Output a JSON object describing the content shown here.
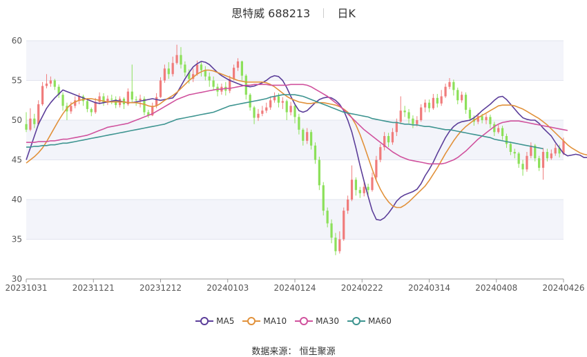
{
  "header": {
    "title": "思特威 688213",
    "period": "日K"
  },
  "source": {
    "label": "数据来源：",
    "name": "恒生聚源"
  },
  "chart_data": {
    "type": "candlestick",
    "ylim": [
      30,
      60
    ],
    "yticks": [
      30,
      35,
      40,
      45,
      50,
      55,
      60
    ],
    "xticks": [
      "20231031",
      "20231121",
      "20231212",
      "20240103",
      "20240124",
      "20240222",
      "20240314",
      "20240408",
      "20240426"
    ],
    "grid": true,
    "legend_position": "bottom",
    "up_color": "#f07c7c",
    "down_color": "#8ce05a",
    "candles": [
      [
        49.5,
        48.8,
        51.0,
        48.5
      ],
      [
        48.8,
        50.2,
        51.5,
        48.6
      ],
      [
        50.2,
        49.5,
        50.8,
        49.0
      ],
      [
        49.5,
        52.0,
        52.5,
        49.3
      ],
      [
        52.0,
        54.3,
        54.8,
        51.8
      ],
      [
        54.3,
        54.6,
        55.8,
        54.0
      ],
      [
        54.6,
        55.0,
        55.5,
        54.2
      ],
      [
        55.0,
        54.2,
        55.2,
        53.8
      ],
      [
        54.2,
        53.2,
        54.5,
        52.8
      ],
      [
        53.2,
        51.8,
        53.5,
        51.2
      ],
      [
        51.8,
        51.1,
        52.2,
        50.0
      ],
      [
        51.1,
        51.8,
        52.3,
        50.8
      ],
      [
        51.8,
        52.5,
        53.0,
        51.5
      ],
      [
        52.5,
        53.0,
        53.4,
        52.0
      ],
      [
        53.0,
        52.4,
        53.2,
        51.8
      ],
      [
        52.4,
        51.4,
        52.6,
        51.0
      ],
      [
        51.4,
        51.0,
        51.6,
        50.5
      ],
      [
        51.0,
        52.3,
        52.8,
        50.8
      ],
      [
        52.3,
        53.0,
        53.5,
        52.0
      ],
      [
        53.0,
        52.2,
        53.4,
        51.8
      ],
      [
        52.2,
        52.7,
        53.1,
        51.9
      ],
      [
        52.7,
        52.6,
        53.2,
        52.0
      ],
      [
        52.6,
        51.9,
        53.0,
        51.5
      ],
      [
        51.9,
        52.7,
        53.0,
        51.6
      ],
      [
        52.7,
        52.0,
        52.9,
        51.4
      ],
      [
        52.0,
        53.6,
        54.0,
        51.8
      ],
      [
        53.6,
        52.6,
        57.0,
        52.2
      ],
      [
        52.6,
        52.5,
        53.0,
        51.8
      ],
      [
        52.5,
        52.7,
        53.2,
        51.6
      ],
      [
        52.7,
        51.0,
        53.0,
        50.6
      ],
      [
        51.0,
        50.6,
        51.3,
        50.3
      ],
      [
        50.6,
        51.8,
        52.2,
        50.5
      ],
      [
        51.8,
        52.9,
        53.4,
        51.5
      ],
      [
        52.9,
        55.0,
        55.4,
        52.8
      ],
      [
        55.0,
        56.5,
        57.0,
        54.7
      ],
      [
        56.5,
        55.8,
        57.3,
        55.2
      ],
      [
        55.8,
        57.2,
        58.0,
        55.5
      ],
      [
        57.2,
        58.2,
        59.5,
        57.0
      ],
      [
        58.2,
        57.0,
        59.2,
        56.5
      ],
      [
        57.0,
        56.0,
        57.4,
        55.5
      ],
      [
        56.0,
        55.2,
        56.4,
        54.6
      ],
      [
        55.2,
        55.8,
        56.5,
        54.8
      ],
      [
        55.8,
        57.0,
        57.5,
        55.6
      ],
      [
        57.0,
        56.3,
        57.3,
        55.5
      ],
      [
        56.3,
        55.5,
        56.8,
        55.0
      ],
      [
        55.5,
        55.0,
        56.0,
        54.2
      ],
      [
        55.0,
        54.2,
        55.5,
        53.8
      ],
      [
        54.2,
        53.6,
        54.6,
        53.0
      ],
      [
        53.6,
        54.2,
        54.6,
        53.2
      ],
      [
        54.2,
        53.7,
        54.8,
        53.1
      ],
      [
        53.7,
        55.2,
        55.6,
        53.4
      ],
      [
        55.2,
        56.6,
        57.0,
        55.0
      ],
      [
        56.6,
        57.4,
        57.8,
        56.2
      ],
      [
        57.4,
        55.6,
        57.5,
        55.0
      ],
      [
        55.6,
        53.2,
        55.8,
        52.6
      ],
      [
        53.2,
        51.6,
        53.4,
        51.2
      ],
      [
        51.6,
        50.3,
        51.8,
        49.5
      ],
      [
        50.3,
        50.8,
        51.4,
        49.9
      ],
      [
        50.8,
        51.2,
        51.8,
        50.5
      ],
      [
        51.2,
        51.6,
        52.2,
        50.9
      ],
      [
        51.6,
        52.5,
        53.0,
        51.3
      ],
      [
        52.5,
        53.0,
        53.5,
        52.2
      ],
      [
        53.0,
        52.2,
        53.4,
        51.6
      ],
      [
        52.2,
        52.4,
        52.9,
        51.4
      ],
      [
        52.4,
        51.0,
        52.6,
        50.0
      ],
      [
        51.0,
        51.8,
        52.3,
        50.6
      ],
      [
        51.8,
        50.4,
        52.0,
        49.6
      ],
      [
        50.4,
        48.8,
        50.8,
        48.2
      ],
      [
        48.8,
        47.4,
        49.0,
        46.8
      ],
      [
        47.4,
        48.5,
        49.0,
        47.0
      ],
      [
        48.5,
        46.8,
        48.8,
        46.3
      ],
      [
        46.8,
        45.0,
        47.2,
        44.5
      ],
      [
        45.0,
        41.8,
        45.4,
        41.2
      ],
      [
        41.8,
        38.6,
        42.2,
        38.0
      ],
      [
        38.6,
        37.0,
        39.0,
        36.5
      ],
      [
        37.0,
        35.2,
        37.5,
        34.5
      ],
      [
        35.2,
        33.5,
        35.8,
        33.0
      ],
      [
        33.5,
        35.0,
        36.0,
        33.2
      ],
      [
        35.0,
        38.6,
        39.0,
        34.8
      ],
      [
        38.6,
        40.0,
        40.5,
        38.2
      ],
      [
        40.0,
        42.5,
        44.3,
        39.8
      ],
      [
        42.5,
        41.2,
        42.8,
        40.5
      ],
      [
        41.2,
        40.8,
        41.6,
        40.2
      ],
      [
        40.8,
        41.6,
        42.2,
        40.4
      ],
      [
        41.6,
        41.2,
        42.0,
        40.6
      ],
      [
        41.2,
        42.8,
        43.4,
        41.0
      ],
      [
        42.8,
        45.0,
        45.5,
        42.5
      ],
      [
        45.0,
        46.6,
        47.0,
        44.7
      ],
      [
        46.6,
        48.0,
        48.5,
        46.2
      ],
      [
        48.0,
        47.2,
        48.4,
        46.6
      ],
      [
        47.2,
        48.5,
        49.0,
        46.9
      ],
      [
        48.5,
        49.8,
        50.2,
        48.0
      ],
      [
        49.8,
        51.2,
        53.0,
        49.5
      ],
      [
        51.2,
        51.0,
        51.8,
        50.4
      ],
      [
        51.0,
        50.2,
        51.4,
        49.6
      ],
      [
        50.2,
        49.5,
        50.6,
        49.0
      ],
      [
        49.5,
        50.0,
        50.5,
        49.2
      ],
      [
        50.0,
        51.6,
        52.0,
        49.8
      ],
      [
        51.6,
        52.2,
        52.6,
        51.0
      ],
      [
        52.2,
        51.5,
        52.6,
        51.0
      ],
      [
        51.5,
        52.8,
        53.3,
        51.3
      ],
      [
        52.8,
        52.1,
        53.3,
        51.6
      ],
      [
        52.1,
        53.0,
        53.8,
        51.8
      ],
      [
        53.0,
        54.2,
        54.6,
        52.8
      ],
      [
        54.2,
        54.8,
        55.3,
        53.9
      ],
      [
        54.8,
        53.8,
        55.1,
        53.1
      ],
      [
        53.8,
        52.5,
        54.1,
        52.0
      ],
      [
        52.5,
        53.2,
        53.6,
        52.2
      ],
      [
        53.2,
        51.3,
        53.5,
        50.8
      ],
      [
        51.3,
        50.2,
        51.6,
        49.9
      ],
      [
        50.2,
        49.8,
        50.6,
        49.3
      ],
      [
        49.8,
        50.5,
        50.9,
        49.5
      ],
      [
        50.5,
        50.0,
        50.8,
        49.6
      ],
      [
        50.0,
        50.4,
        50.8,
        49.5
      ],
      [
        50.4,
        49.5,
        50.7,
        49.0
      ],
      [
        49.5,
        48.5,
        49.8,
        48.0
      ],
      [
        48.5,
        49.0,
        49.4,
        48.3
      ],
      [
        49.0,
        48.0,
        49.3,
        47.5
      ],
      [
        48.0,
        47.0,
        48.3,
        46.5
      ],
      [
        47.0,
        46.0,
        47.3,
        45.6
      ],
      [
        46.0,
        45.8,
        46.4,
        45.2
      ],
      [
        45.8,
        44.5,
        46.0,
        44.0
      ],
      [
        44.5,
        43.8,
        45.0,
        43.0
      ],
      [
        43.8,
        45.5,
        46.0,
        43.5
      ],
      [
        45.5,
        46.8,
        47.2,
        45.2
      ],
      [
        46.8,
        45.2,
        47.0,
        44.8
      ],
      [
        45.2,
        44.0,
        45.5,
        43.6
      ],
      [
        44.0,
        46.0,
        46.5,
        42.5
      ],
      [
        46.0,
        45.2,
        46.4,
        44.8
      ],
      [
        45.2,
        45.8,
        46.3,
        45.0
      ],
      [
        45.8,
        46.5,
        47.0,
        45.5
      ],
      [
        46.5,
        45.8,
        46.9,
        45.3
      ],
      [
        45.8,
        47.4,
        47.8,
        45.6
      ]
    ],
    "series": [
      {
        "name": "MA5",
        "color": "#5b3d99",
        "values": [
          45.0,
          46.5,
          48.0,
          49.5,
          50.5,
          51.5,
          52.2,
          52.8,
          53.3,
          53.8,
          53.6,
          53.4,
          53.2,
          53.0,
          52.8,
          52.6,
          52.4,
          52.2,
          52.1,
          52.2,
          52.3,
          52.4,
          52.5,
          52.4,
          52.3,
          52.2,
          52.2,
          52.3,
          52.4,
          52.5,
          52.6,
          52.7,
          52.6,
          52.5,
          52.6,
          52.7,
          52.8,
          53.4,
          54.3,
          55.2,
          56.0,
          56.7,
          57.1,
          57.4,
          57.3,
          57.0,
          56.5,
          56.0,
          55.6,
          55.3,
          55.0,
          54.8,
          54.6,
          54.4,
          54.3,
          54.2,
          54.3,
          54.5,
          54.7,
          55.0,
          55.4,
          55.6,
          55.5,
          55.0,
          54.1,
          53.0,
          52.0,
          51.2,
          51.0,
          51.2,
          51.7,
          52.2,
          52.6,
          52.8,
          52.9,
          52.8,
          52.5,
          52.0,
          51.2,
          50.0,
          48.5,
          46.5,
          44.3,
          42.3,
          40.4,
          38.6,
          37.5,
          37.4,
          37.7,
          38.3,
          39.0,
          39.8,
          40.3,
          40.6,
          40.8,
          41.0,
          41.3,
          42.0,
          43.0,
          43.8,
          44.7,
          45.8,
          46.8,
          47.8,
          48.6,
          49.2,
          49.6,
          49.8,
          49.9,
          50.0,
          50.3,
          50.7,
          51.2,
          51.6,
          52.0,
          52.5,
          52.9,
          53.0,
          52.6,
          52.0,
          51.4,
          50.8,
          50.3,
          50.1,
          50.0,
          50.0,
          49.6,
          49.0,
          48.5,
          48.0,
          47.2,
          46.5,
          45.8,
          45.5,
          45.6,
          45.7,
          45.6,
          45.3,
          45.3,
          45.5,
          45.7,
          45.9,
          45.8,
          46.0
        ]
      },
      {
        "name": "MA10",
        "color": "#e1913a",
        "values": [
          44.6,
          45.0,
          45.4,
          45.9,
          46.5,
          47.3,
          48.2,
          49.1,
          50.0,
          50.8,
          51.5,
          52.0,
          52.3,
          52.5,
          52.6,
          52.7,
          52.7,
          52.6,
          52.5,
          52.4,
          52.3,
          52.3,
          52.3,
          52.3,
          52.3,
          52.2,
          52.2,
          52.2,
          52.1,
          52.0,
          51.8,
          51.7,
          51.8,
          52.1,
          52.5,
          52.8,
          53.1,
          53.5,
          54.0,
          54.5,
          55.0,
          55.4,
          55.8,
          56.1,
          56.3,
          56.3,
          56.2,
          56.0,
          55.8,
          55.6,
          55.4,
          55.2,
          55.0,
          54.9,
          54.8,
          54.8,
          54.8,
          54.8,
          54.8,
          54.7,
          54.5,
          54.2,
          53.8,
          53.4,
          53.0,
          52.7,
          52.5,
          52.3,
          52.2,
          52.1,
          52.1,
          52.2,
          52.2,
          52.2,
          52.1,
          52.0,
          51.9,
          51.7,
          51.4,
          51.0,
          50.3,
          49.4,
          48.2,
          46.8,
          45.3,
          43.8,
          42.4,
          41.3,
          40.4,
          39.7,
          39.2,
          39.0,
          39.0,
          39.3,
          39.7,
          40.2,
          40.7,
          41.2,
          41.7,
          42.4,
          43.2,
          44.0,
          44.9,
          45.8,
          46.6,
          47.4,
          48.1,
          48.7,
          49.2,
          49.6,
          50.0,
          50.3,
          50.6,
          50.9,
          51.2,
          51.5,
          51.8,
          51.9,
          51.9,
          51.9,
          51.8,
          51.6,
          51.4,
          51.1,
          50.8,
          50.5,
          50.2,
          49.8,
          49.4,
          48.9,
          48.4,
          47.9,
          47.4,
          46.9,
          46.5,
          46.2,
          45.9,
          45.7,
          45.6,
          45.5,
          45.5,
          45.6,
          45.6,
          45.5
        ]
      },
      {
        "name": "MA30",
        "color": "#d0519d",
        "values": [
          47.2,
          47.2,
          47.2,
          47.3,
          47.3,
          47.3,
          47.4,
          47.4,
          47.5,
          47.6,
          47.6,
          47.7,
          47.8,
          47.9,
          48.0,
          48.1,
          48.3,
          48.5,
          48.7,
          48.9,
          49.1,
          49.2,
          49.3,
          49.4,
          49.5,
          49.6,
          49.8,
          50.0,
          50.2,
          50.4,
          50.6,
          50.8,
          51.1,
          51.4,
          51.7,
          52.0,
          52.3,
          52.6,
          52.8,
          53.0,
          53.2,
          53.3,
          53.4,
          53.5,
          53.6,
          53.7,
          53.8,
          53.9,
          53.9,
          54.0,
          54.0,
          54.1,
          54.2,
          54.3,
          54.4,
          54.4,
          54.5,
          54.5,
          54.5,
          54.5,
          54.4,
          54.4,
          54.4,
          54.4,
          54.4,
          54.5,
          54.5,
          54.5,
          54.5,
          54.4,
          54.2,
          53.9,
          53.6,
          53.3,
          53.0,
          52.6,
          52.2,
          51.8,
          51.3,
          50.8,
          50.3,
          49.8,
          49.3,
          48.8,
          48.4,
          48.0,
          47.6,
          47.2,
          46.8,
          46.4,
          46.0,
          45.7,
          45.4,
          45.2,
          45.0,
          44.9,
          44.8,
          44.7,
          44.6,
          44.5,
          44.5,
          44.5,
          44.5,
          44.6,
          44.8,
          45.0,
          45.3,
          45.7,
          46.1,
          46.6,
          47.1,
          47.6,
          48.0,
          48.4,
          48.8,
          49.2,
          49.5,
          49.7,
          49.8,
          49.9,
          49.9,
          49.9,
          49.8,
          49.7,
          49.6,
          49.5,
          49.4,
          49.3,
          49.2,
          49.1,
          49.0,
          48.9,
          48.8,
          48.7
        ]
      },
      {
        "name": "MA60",
        "color": "#3d9490",
        "values": [
          46.6,
          46.6,
          46.7,
          46.7,
          46.8,
          46.8,
          46.9,
          46.9,
          47.0,
          47.1,
          47.1,
          47.2,
          47.3,
          47.4,
          47.5,
          47.6,
          47.7,
          47.8,
          47.9,
          48.0,
          48.1,
          48.2,
          48.3,
          48.4,
          48.5,
          48.6,
          48.7,
          48.8,
          48.9,
          49.0,
          49.1,
          49.2,
          49.3,
          49.4,
          49.5,
          49.7,
          49.9,
          50.1,
          50.2,
          50.3,
          50.4,
          50.5,
          50.6,
          50.7,
          50.8,
          50.9,
          51.0,
          51.2,
          51.4,
          51.6,
          51.8,
          51.9,
          52.0,
          52.1,
          52.2,
          52.3,
          52.4,
          52.5,
          52.6,
          52.7,
          52.9,
          53.0,
          53.1,
          53.2,
          53.2,
          53.2,
          53.2,
          53.1,
          53.0,
          52.8,
          52.6,
          52.4,
          52.2,
          52.0,
          51.8,
          51.6,
          51.4,
          51.2,
          51.0,
          50.9,
          50.8,
          50.7,
          50.6,
          50.5,
          50.4,
          50.2,
          50.1,
          50.0,
          49.9,
          49.8,
          49.7,
          49.7,
          49.6,
          49.5,
          49.5,
          49.4,
          49.4,
          49.3,
          49.2,
          49.2,
          49.1,
          49.0,
          48.9,
          48.8,
          48.8,
          48.7,
          48.6,
          48.5,
          48.4,
          48.3,
          48.2,
          48.1,
          48.0,
          47.9,
          47.8,
          47.6,
          47.5,
          47.4,
          47.3,
          47.2,
          47.1,
          47.0,
          46.9,
          46.8,
          46.7,
          46.6,
          46.5,
          46.4
        ]
      }
    ]
  }
}
